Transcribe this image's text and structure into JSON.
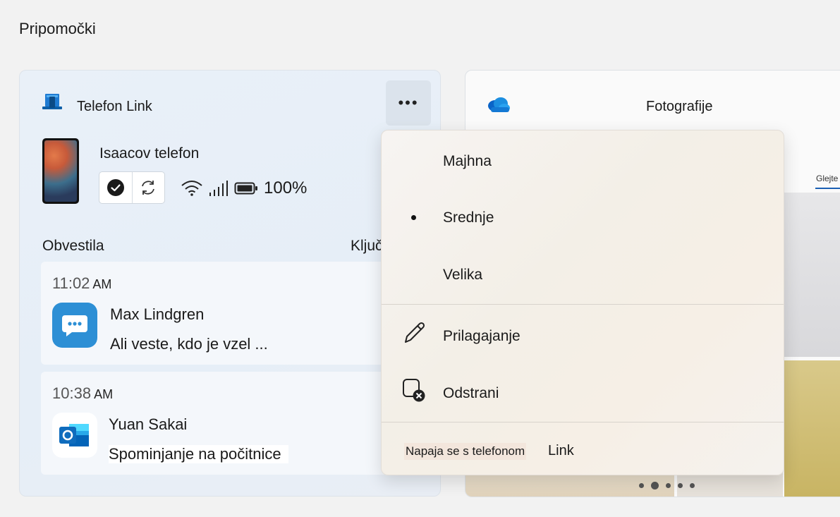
{
  "page": {
    "title": "Pripomočki"
  },
  "phone_widget": {
    "title_part1": "Telefon",
    "title_part2": "Link",
    "more_label": "•••",
    "device_name": "Isaacov telefon",
    "battery": "100%",
    "notifications_title": "Obvestila",
    "notifications_key": "Ključ",
    "notifications": [
      {
        "time": "11:02",
        "ampm": "AM",
        "sender": "Max Lindgren",
        "text": "Ali veste, kdo je vzel ..."
      },
      {
        "time": "10:38",
        "ampm": "AM",
        "sender": "Yuan Sakai",
        "text": "Spominjanje na počitnice"
      }
    ]
  },
  "photos_widget": {
    "title": "Fotografije",
    "tab": "Glejte"
  },
  "context_menu": {
    "size_small": "Majhna",
    "size_medium": "Srednje",
    "size_large": "Velika",
    "selected_size": "Srednje",
    "customize": "Prilagajanje",
    "remove": "Odstrani",
    "footer_text": "Napaja se s telefonom",
    "footer_link": "Link"
  },
  "colors": {
    "accent": "#1a5fb4",
    "messages_icon": "#2d8fd5",
    "outlook": "#0f6cbd"
  }
}
